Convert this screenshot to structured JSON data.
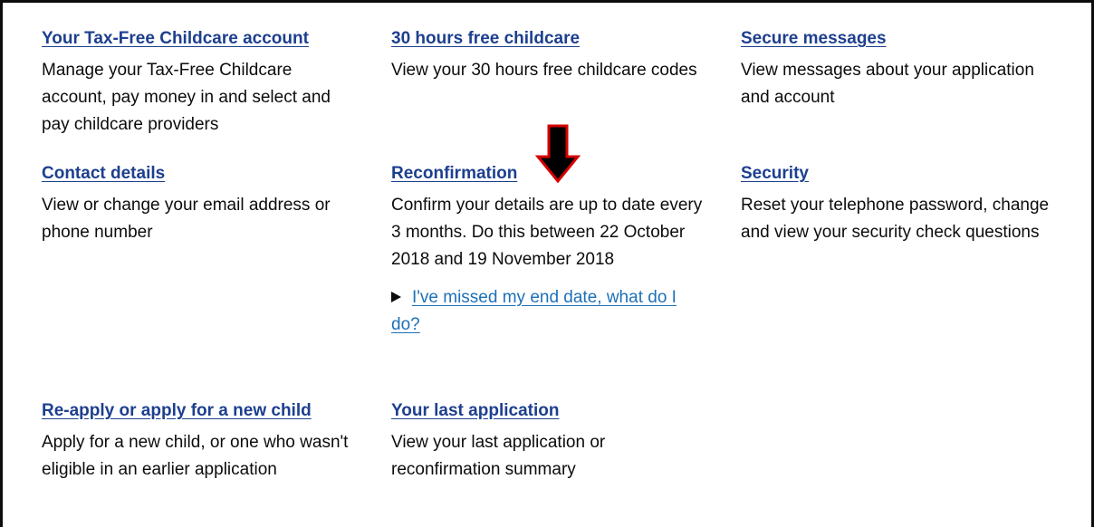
{
  "cards": {
    "tfc_account": {
      "title": "Your Tax-Free Childcare account",
      "description": "Manage your Tax-Free Childcare account, pay money in and select and pay childcare providers"
    },
    "thirty_hours": {
      "title": "30 hours free childcare",
      "description": "View your 30 hours free childcare codes"
    },
    "secure_messages": {
      "title": "Secure messages",
      "description": "View messages about your application and account"
    },
    "contact_details": {
      "title": "Contact details",
      "description": "View or change your email address or phone number"
    },
    "reconfirmation": {
      "title": "Reconfirmation",
      "description": "Confirm your details are up to date every 3 months. Do this between 22 October 2018 and 19 November 2018",
      "details_summary": "I've missed my end date, what do I do?"
    },
    "security": {
      "title": "Security",
      "description": "Reset your telephone password, change and view your security check questions"
    },
    "reapply": {
      "title": "Re-apply or apply for a new child",
      "description": "Apply for a new child, or one who wasn't eligible in an earlier application"
    },
    "last_application": {
      "title": "Your last application",
      "description": "View your last application or reconfirmation summary"
    }
  },
  "colors": {
    "link": "#1d3f8f",
    "details_link": "#1d70b8",
    "text": "#0b0c0c",
    "annotation_arrow": "#d40000"
  },
  "annotation": {
    "icon": "arrow-down-icon"
  }
}
